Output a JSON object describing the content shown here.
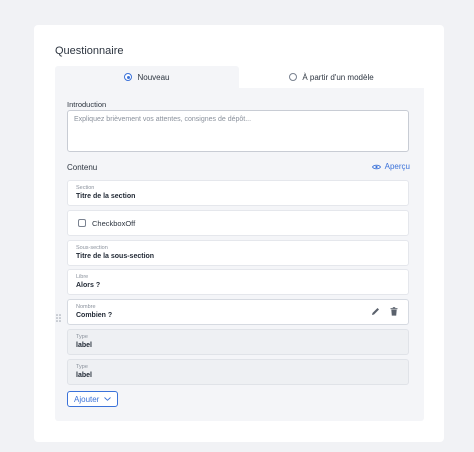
{
  "card": {
    "title": "Questionnaire"
  },
  "tabs": [
    {
      "label": "Nouveau",
      "selected": true
    },
    {
      "label": "À partir d'un modèle",
      "selected": false
    }
  ],
  "introduction": {
    "label": "Introduction",
    "placeholder": "Expliquez brièvement vos attentes, consignes de dépôt..."
  },
  "contenu": {
    "label": "Contenu",
    "preview_label": "Aperçu"
  },
  "items": [
    {
      "type_label": "Section",
      "value": "Titre de la section"
    },
    {
      "checkbox_label": "CheckboxOff"
    },
    {
      "type_label": "Sous-section",
      "value": "Titre de la sous-section"
    },
    {
      "type_label": "Libre",
      "value": "Alors ?"
    },
    {
      "type_label": "Nombre",
      "value": "Combien ?"
    },
    {
      "type_label": "Type",
      "value": "label"
    },
    {
      "type_label": "Type",
      "value": "label"
    }
  ],
  "add_button": {
    "label": "Ajouter"
  },
  "colors": {
    "accent": "#3b72d9",
    "panel": "#f4f5f8"
  }
}
